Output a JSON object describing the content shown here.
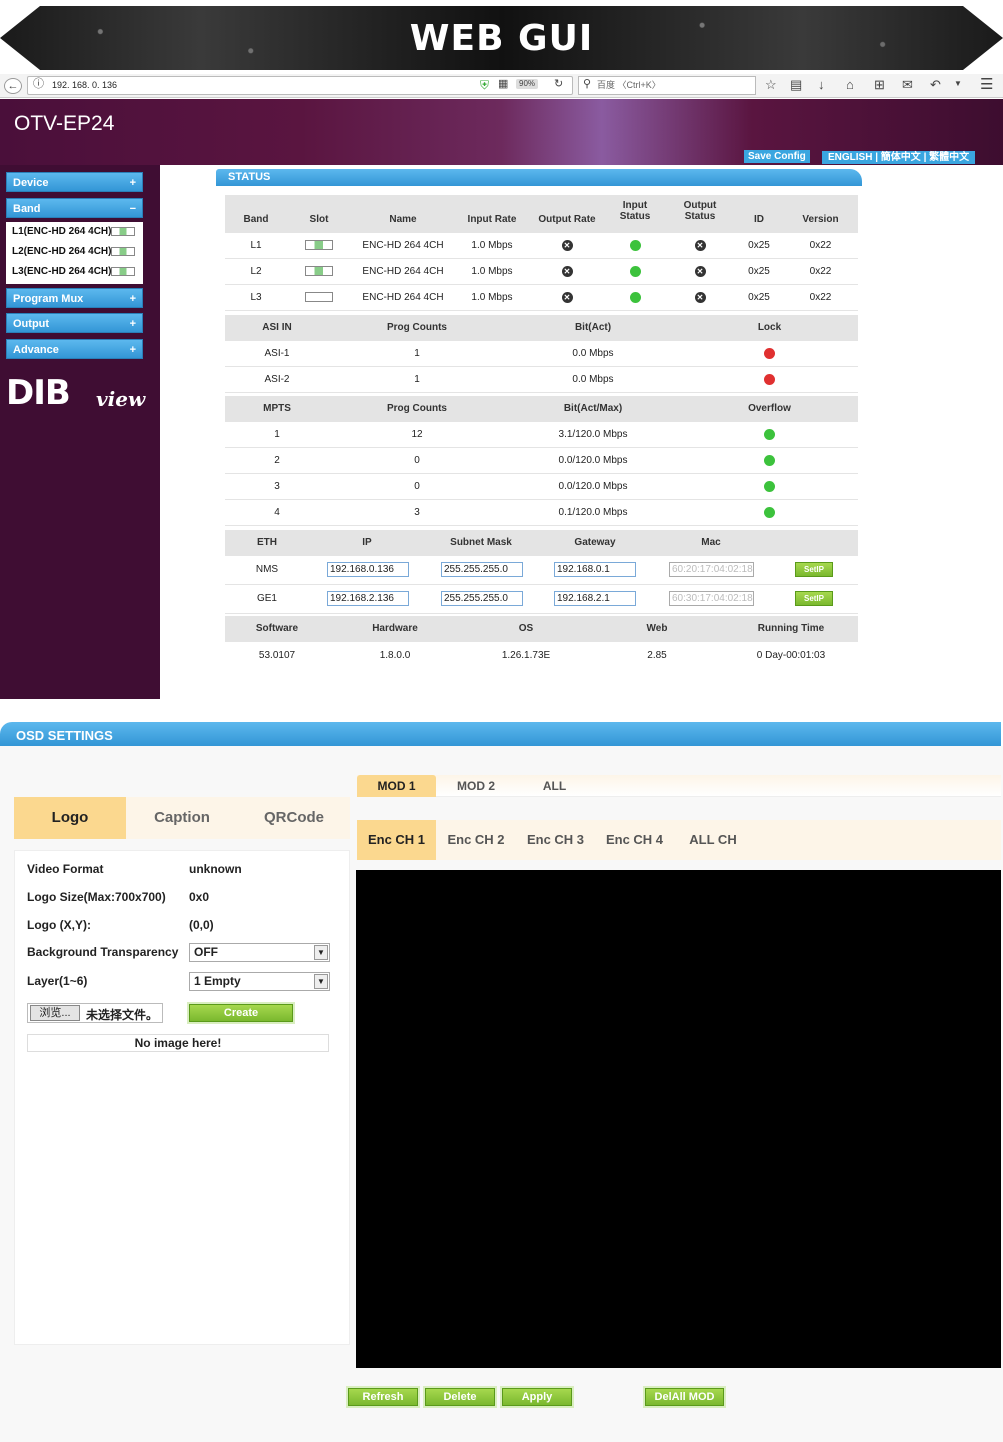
{
  "banner": {
    "title": "WEB GUI"
  },
  "browser": {
    "url": "192. 168. 0. 136",
    "zoom": "90%",
    "search_placeholder": "百度 〈Ctrl+K〉"
  },
  "app": {
    "title": "OTV-EP24",
    "save_config": "Save Config",
    "languages": "ENGLISH | 簡体中文 | 繁體中文"
  },
  "sidebar": {
    "device": "Device",
    "band": "Band",
    "program_mux": "Program Mux",
    "output": "Output",
    "advance": "Advance",
    "plus": "+",
    "minus": "−",
    "band_items": [
      "L1(ENC-HD 264 4CH)",
      "L2(ENC-HD 264 4CH)",
      "L3(ENC-HD 264 4CH)"
    ],
    "logo_main": "DIB",
    "logo_sub": "view"
  },
  "status": {
    "title": "STATUS",
    "band_headers": [
      "Band",
      "Slot",
      "Name",
      "Input Rate",
      "Output Rate",
      "Input Status",
      "Output Status",
      "ID",
      "Version"
    ],
    "bands": [
      {
        "band": "L1",
        "name": "ENC-HD 264 4CH",
        "input_rate": "1.0 Mbps",
        "id": "0x25",
        "version": "0x22"
      },
      {
        "band": "L2",
        "name": "ENC-HD 264 4CH",
        "input_rate": "1.0 Mbps",
        "id": "0x25",
        "version": "0x22"
      },
      {
        "band": "L3",
        "name": "ENC-HD 264 4CH",
        "input_rate": "1.0 Mbps",
        "id": "0x25",
        "version": "0x22"
      }
    ],
    "asi_headers": [
      "ASI IN",
      "Prog Counts",
      "Bit(Act)",
      "Lock"
    ],
    "asi": [
      {
        "name": "ASI-1",
        "prog": "1",
        "bit": "0.0 Mbps"
      },
      {
        "name": "ASI-2",
        "prog": "1",
        "bit": "0.0 Mbps"
      }
    ],
    "mpts_headers": [
      "MPTS",
      "Prog Counts",
      "Bit(Act/Max)",
      "Overflow"
    ],
    "mpts": [
      {
        "id": "1",
        "prog": "12",
        "bit": "3.1/120.0 Mbps"
      },
      {
        "id": "2",
        "prog": "0",
        "bit": "0.0/120.0 Mbps"
      },
      {
        "id": "3",
        "prog": "0",
        "bit": "0.0/120.0 Mbps"
      },
      {
        "id": "4",
        "prog": "3",
        "bit": "0.1/120.0 Mbps"
      }
    ],
    "eth_headers": [
      "ETH",
      "IP",
      "Subnet Mask",
      "Gateway",
      "Mac"
    ],
    "eth": [
      {
        "name": "NMS",
        "ip": "192.168.0.136",
        "mask": "255.255.255.0",
        "gw": "192.168.0.1",
        "mac": "60:20:17:04:02:18",
        "btn": "SetIP"
      },
      {
        "name": "GE1",
        "ip": "192.168.2.136",
        "mask": "255.255.255.0",
        "gw": "192.168.2.1",
        "mac": "60:30:17:04:02:18",
        "btn": "SetIP"
      }
    ],
    "sw_headers": [
      "Software",
      "Hardware",
      "OS",
      "Web",
      "Running Time"
    ],
    "sw": {
      "software": "53.0107",
      "hardware": "1.8.0.0",
      "os": "1.26.1.73E",
      "web": "2.85",
      "running": "0 Day-00:01:03"
    }
  },
  "osd": {
    "title": "OSD SETTINGS",
    "mod_tabs": [
      "MOD 1",
      "MOD 2",
      "ALL"
    ],
    "enc_tabs": [
      "Enc CH 1",
      "Enc CH 2",
      "Enc CH 3",
      "Enc CH 4",
      "ALL CH"
    ],
    "left_tabs": [
      "Logo",
      "Caption",
      "QRCode"
    ],
    "fields": {
      "video_format_label": "Video Format",
      "video_format": "unknown",
      "logo_size_label": "Logo Size(Max:700x700)",
      "logo_size": "0x0",
      "logo_xy_label": "Logo (X,Y):",
      "logo_xy": "(0,0)",
      "bg_label": "Background Transparency",
      "bg": "OFF",
      "layer_label": "Layer(1~6)",
      "layer": "1 Empty"
    },
    "browse_btn": "浏览...",
    "browse_txt": "未选择文件。",
    "create_btn": "Create",
    "no_image": "No image here!",
    "actions": {
      "refresh": "Refresh",
      "delete": "Delete",
      "apply": "Apply",
      "delall": "DelAll MOD"
    }
  }
}
